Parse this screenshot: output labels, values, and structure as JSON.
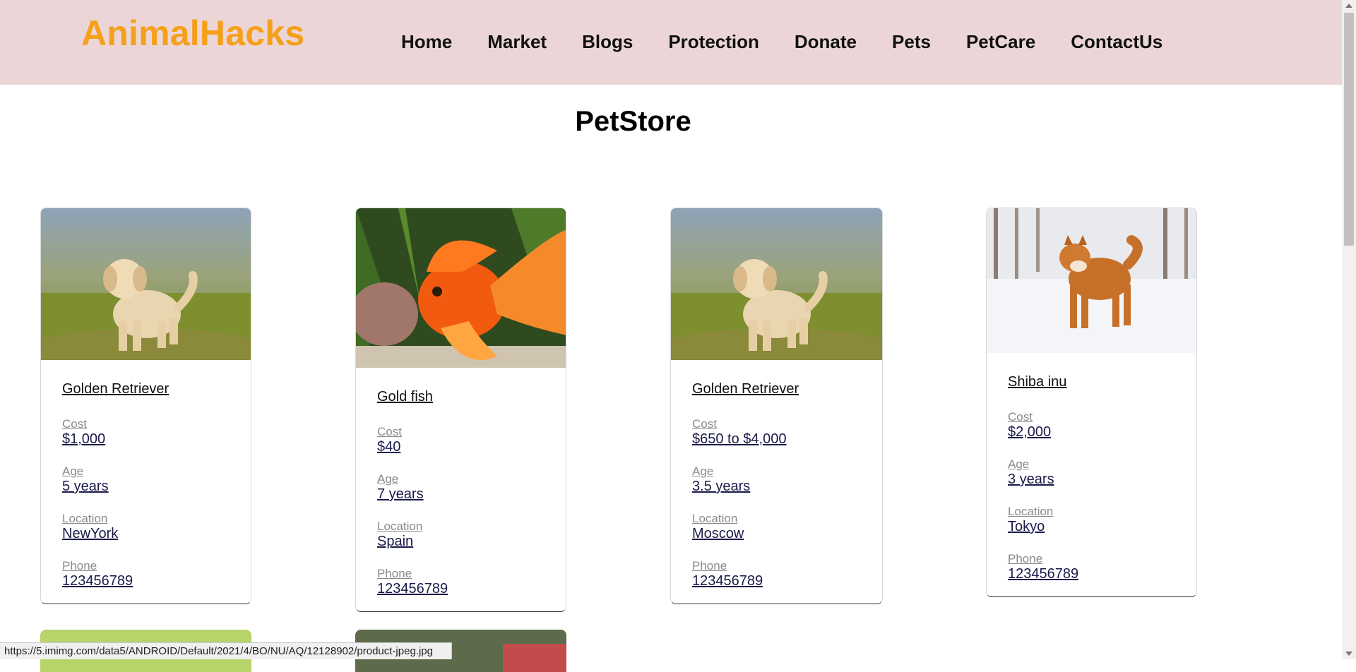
{
  "header": {
    "brand": "AnimalHacks",
    "nav": [
      "Home",
      "Market",
      "Blogs",
      "Protection",
      "Donate",
      "Pets",
      "PetCare",
      "ContactUs"
    ]
  },
  "page": {
    "title": "PetStore"
  },
  "cards": [
    {
      "name": "Golden Retriever",
      "cost_label": "Cost",
      "cost": "$1,000",
      "age_label": "Age",
      "age": "5 years",
      "location_label": "Location",
      "location": "NewYork",
      "phone_label": "Phone",
      "phone": "123456789",
      "image": "golden-retriever-puppy"
    },
    {
      "name": "Gold fish",
      "cost_label": "Cost",
      "cost": "$40",
      "age_label": "Age",
      "age": "7 years",
      "location_label": "Location",
      "location": "Spain",
      "phone_label": "Phone",
      "phone": "123456789",
      "image": "goldfish"
    },
    {
      "name": "Golden Retriever",
      "cost_label": "Cost",
      "cost": "$650 to $4,000",
      "age_label": "Age",
      "age": "3.5 years",
      "location_label": "Location",
      "location": "Moscow",
      "phone_label": "Phone",
      "phone": "123456789",
      "image": "golden-retriever-puppy"
    },
    {
      "name": "Shiba inu",
      "cost_label": "Cost",
      "cost": "$2,000",
      "age_label": "Age",
      "age": "3 years",
      "location_label": "Location",
      "location": "Tokyo",
      "phone_label": "Phone",
      "phone": "123456789",
      "image": "shiba-inu"
    }
  ],
  "status_bar": {
    "url": "https://5.imimg.com/data5/ANDROID/Default/2021/4/BO/NU/AQ/12128902/product-jpeg.jpg"
  },
  "colors": {
    "header_bg": "#ecd5d6",
    "brand": "#f5a01a"
  }
}
